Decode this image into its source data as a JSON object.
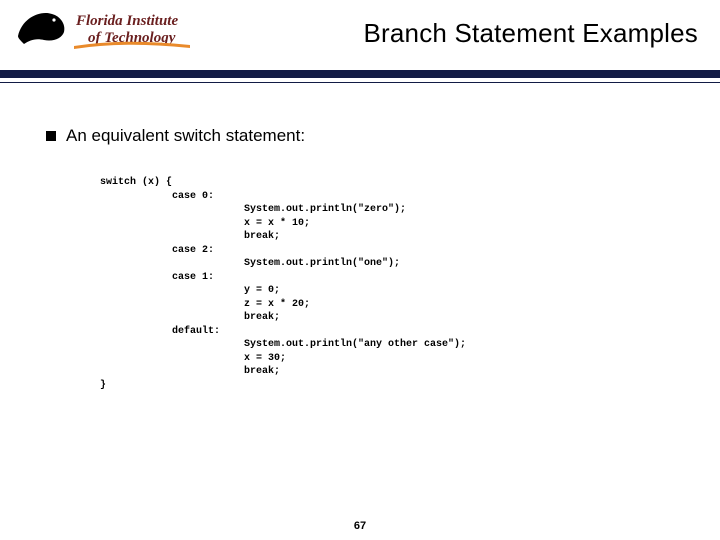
{
  "header": {
    "title": "Branch Statement Examples",
    "logo_text_top": "Florida Institute",
    "logo_text_bottom": "of Technology"
  },
  "bullet": {
    "text": "An equivalent switch statement:"
  },
  "code": {
    "lines": [
      "switch (x) {",
      "            case 0:",
      "                        System.out.println(\"zero\");",
      "                        x = x * 10;",
      "                        break;",
      "            case 2:",
      "                        System.out.println(\"one\");",
      "            case 1:",
      "                        y = 0;",
      "                        z = x * 20;",
      "                        break;",
      "            default:",
      "                        System.out.println(\"any other case\");",
      "                        x = 30;",
      "                        break;",
      "}"
    ]
  },
  "page_number": "67",
  "logo_colors": {
    "maroon": "#6a1f1f",
    "orange": "#e98a2b"
  }
}
